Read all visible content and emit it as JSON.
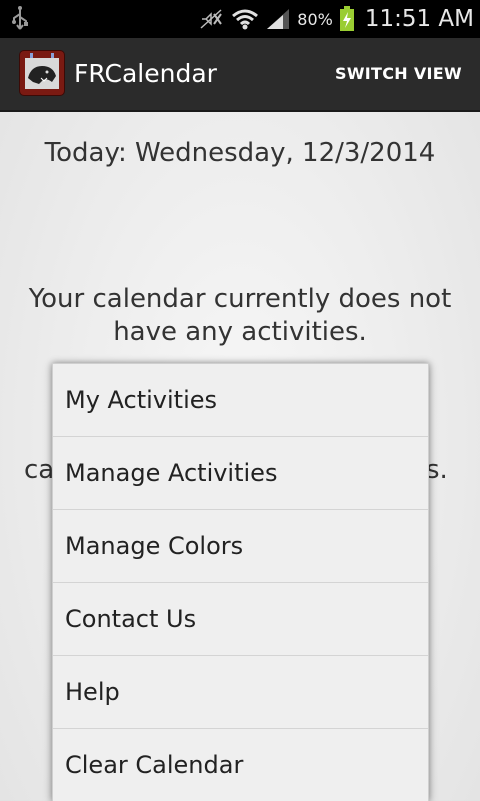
{
  "status_bar": {
    "battery_percent": "80%",
    "time": "11:51 AM",
    "icons": [
      "usb-icon",
      "mute-icon",
      "wifi-icon",
      "signal-icon",
      "battery-charging-icon"
    ]
  },
  "action_bar": {
    "title": "FRCalendar",
    "switch_view_label": "SWITCH VIEW"
  },
  "main": {
    "today_text": "Today: Wednesday, 12/3/2014",
    "empty_message": "Your calendar currently does not have any activities.",
    "hidden_line_left": "ca",
    "hidden_line_right": "s."
  },
  "menu": {
    "items": [
      {
        "label": "My Activities"
      },
      {
        "label": "Manage Activities"
      },
      {
        "label": "Manage Colors"
      },
      {
        "label": "Contact Us"
      },
      {
        "label": "Help"
      },
      {
        "label": "Clear Calendar"
      }
    ]
  },
  "colors": {
    "action_bar_bg": "#2b2b2b",
    "status_bar_bg": "#000000",
    "battery_green": "#9acd32",
    "menu_bg": "#efefef"
  }
}
